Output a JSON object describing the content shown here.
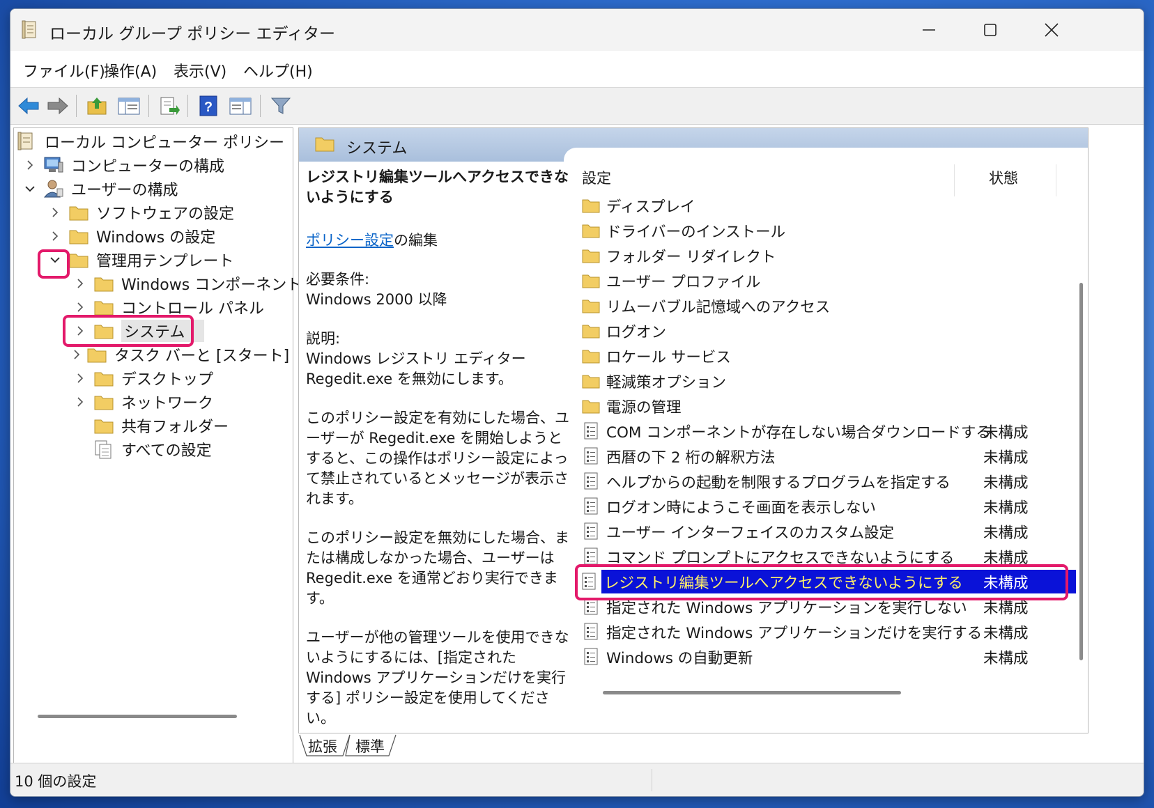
{
  "window": {
    "title": "ローカル グループ ポリシー エディター"
  },
  "menu": [
    "ファイル(F)",
    "操作(A)",
    "表示(V)",
    "ヘルプ(H)"
  ],
  "tree": {
    "root": "ローカル コンピューター ポリシー",
    "computer_config": "コンピューターの構成",
    "user_config": "ユーザーの構成",
    "software_settings": "ソフトウェアの設定",
    "windows_settings": "Windows の設定",
    "admin_templates": "管理用テンプレート",
    "windows_components": "Windows コンポーネント",
    "control_panel": "コントロール パネル",
    "system": "システム",
    "taskbar_start": "タスク バーと [スタート] メニュー",
    "desktop": "デスクトップ",
    "network": "ネットワーク",
    "shared_folders": "共有フォルダー",
    "all_settings": "すべての設定"
  },
  "right": {
    "header": "システム",
    "desc": {
      "title": "レジストリ編集ツールへアクセスできないようにする",
      "edit_link": "ポリシー設定",
      "edit_suffix": "の編集",
      "req_label": "必要条件:",
      "req_value": "Windows 2000 以降",
      "desc_label": "説明:",
      "desc_text": "Windows レジストリ エディター Regedit.exe を無効にします。",
      "p1": "このポリシー設定を有効にした場合、ユーザーが Regedit.exe を開始しようとすると、この操作はポリシー設定によって禁止されているとメッセージが表示されます。",
      "p2": "このポリシー設定を無効にした場合、または構成しなかった場合、ユーザーは Regedit.exe を通常どおり実行できます。",
      "p3": "ユーザーが他の管理ツールを使用できないようにするには、[指定された Windows アプリケーションだけを実行する] ポリシー設定を使用してください。"
    },
    "col_setting": "設定",
    "col_state": "状態",
    "folders": [
      "ディスプレイ",
      "ドライバーのインストール",
      "フォルダー リダイレクト",
      "ユーザー プロファイル",
      "リムーバブル記憶域へのアクセス",
      "ログオン",
      "ロケール サービス",
      "軽減策オプション",
      "電源の管理"
    ],
    "settings": [
      {
        "name": "COM コンポーネントが存在しない場合ダウンロードする",
        "state": "未構成"
      },
      {
        "name": "西暦の下 2 桁の解釈方法",
        "state": "未構成"
      },
      {
        "name": "ヘルプからの起動を制限するプログラムを指定する",
        "state": "未構成"
      },
      {
        "name": "ログオン時にようこそ画面を表示しない",
        "state": "未構成"
      },
      {
        "name": "ユーザー インターフェイスのカスタム設定",
        "state": "未構成"
      },
      {
        "name": "コマンド プロンプトにアクセスできないようにする",
        "state": "未構成"
      },
      {
        "name": "レジストリ編集ツールへアクセスできないようにする",
        "state": "未構成"
      },
      {
        "name": "指定された Windows アプリケーションを実行しない",
        "state": "未構成"
      },
      {
        "name": "指定された Windows アプリケーションだけを実行する",
        "state": "未構成"
      },
      {
        "name": "Windows の自動更新",
        "state": "未構成"
      }
    ]
  },
  "tabs": [
    "拡張",
    "標準"
  ],
  "status": "10 個の設定",
  "colors": {
    "selection": "#0a12d8",
    "highlight": "#e3196a"
  }
}
